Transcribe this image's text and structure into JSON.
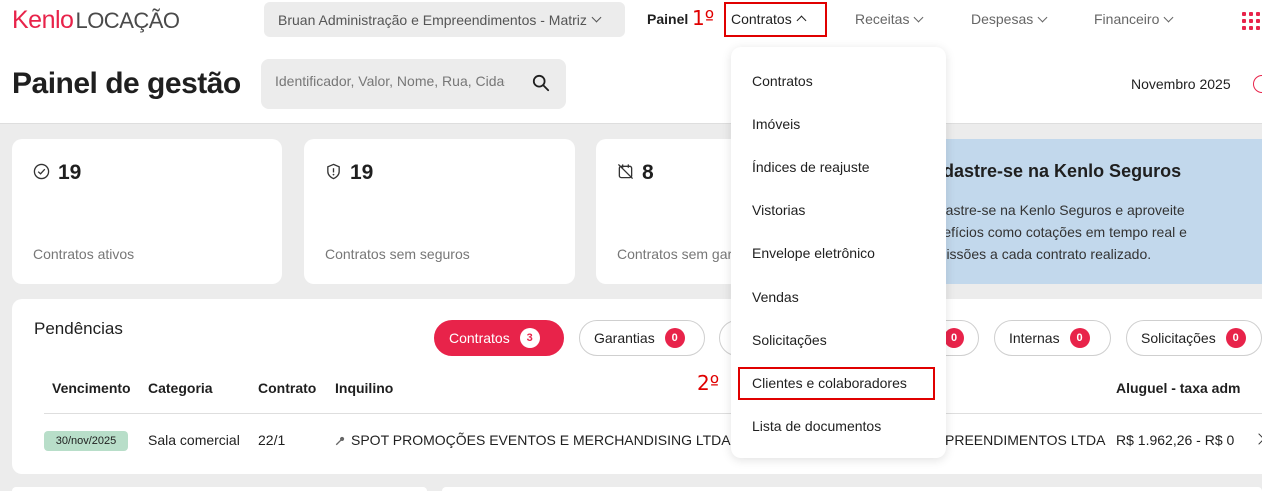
{
  "topbar": {
    "logo_brand": "Kenlo",
    "logo_sub": "LOCAÇÃO",
    "company": "Bruan Administração e Empreendimentos - Matriz",
    "nav": [
      "Painel",
      "Contratos",
      "Receitas",
      "Despesas",
      "Financeiro"
    ],
    "accent": "#e8234a"
  },
  "annotations": {
    "step1": "1º",
    "step2": "2º"
  },
  "header": {
    "title": "Painel de gestão",
    "search_placeholder": "Identificador, Valor, Nome, Rua, Cidade",
    "month": "Novembro 2025"
  },
  "cards": [
    {
      "value": "19",
      "label": "Contratos ativos",
      "icon": "check-circle-icon"
    },
    {
      "value": "19",
      "label": "Contratos sem seguros",
      "icon": "shield-icon"
    },
    {
      "value": "8",
      "label": "Contratos sem garantia",
      "icon": "no-calendar-icon"
    }
  ],
  "promo": {
    "title": "Cadastre-se na Kenlo Seguros",
    "text": "Cadastre-se na Kenlo Seguros e aproveite benefícios como cotações em tempo real e comissões a cada contrato realizado."
  },
  "pendencias": {
    "title": "Pendências",
    "tabs": [
      {
        "label": "Contratos",
        "count": "3"
      },
      {
        "label": "Garantias",
        "count": "0"
      },
      {
        "label": "",
        "count": "0"
      },
      {
        "label": "Internas",
        "count": "0"
      },
      {
        "label": "Solicitações",
        "count": "0"
      }
    ],
    "columns": [
      "Vencimento",
      "Categoria",
      "Contrato",
      "Inquilino",
      "Aluguel - taxa adm"
    ],
    "row": {
      "date": "30/nov/2025",
      "category": "Sala comercial",
      "contract": "22/1",
      "tenant": "SPOT PROMOÇÕES EVENTOS E MERCHANDISING LTDA",
      "owner": "PREENDIMENTOS LTDA",
      "amount": "R$ 1.962,26 - R$ 0"
    }
  },
  "dropdown": [
    "Contratos",
    "Imóveis",
    "Índices de reajuste",
    "Vistorias",
    "Envelope eletrônico",
    "Vendas",
    "Solicitações",
    "Clientes e colaboradores",
    "Lista de documentos"
  ]
}
